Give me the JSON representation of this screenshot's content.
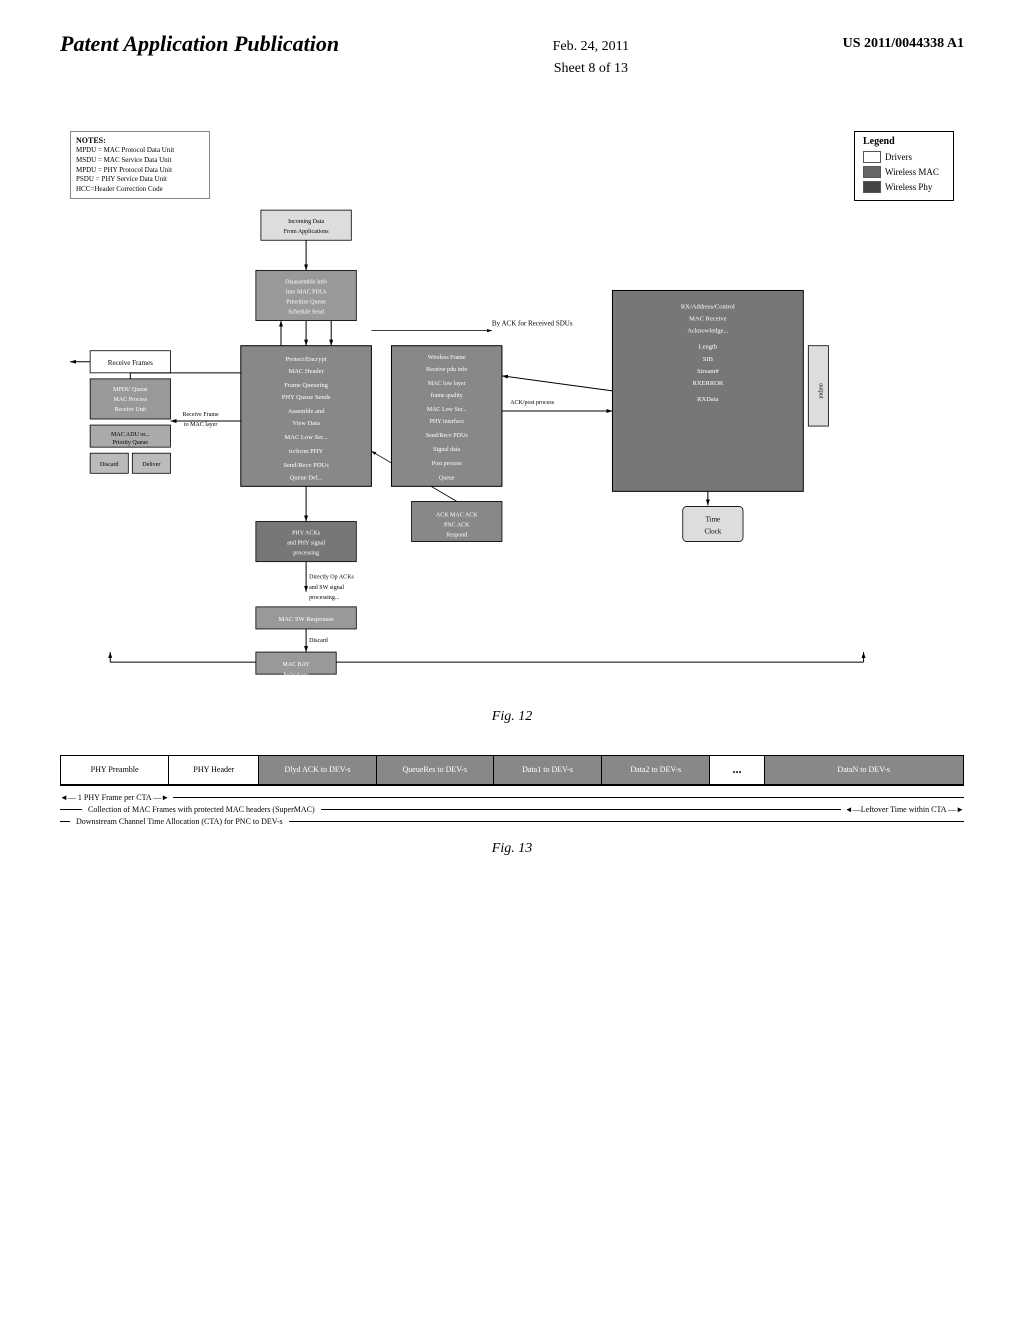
{
  "header": {
    "title": "Patent Application Publication",
    "date": "Feb. 24, 2011",
    "sheet": "Sheet 8 of 13",
    "patent": "US 2011/0044338 A1"
  },
  "fig12": {
    "label": "Fig. 12",
    "notes": {
      "title": "NOTES:",
      "lines": [
        "MPDU = MAC Protocol Data Unit",
        "MSDU = MAC Service Data Unit",
        "MPDU = PHY Protocol Data Unit",
        "PSDU = PHY Service Data Unit",
        "HCC=Header Correction Code"
      ]
    },
    "legend": {
      "title": "Legend",
      "items": [
        {
          "label": "Drivers",
          "shade": "white"
        },
        {
          "label": "Wireless MAC",
          "shade": "dark"
        },
        {
          "label": "Wireless Phy",
          "shade": "darker"
        }
      ]
    }
  },
  "fig13": {
    "label": "Fig. 13",
    "header_cells": [
      {
        "text": "PHY Preamble",
        "shade": "light"
      },
      {
        "text": "PHY Header",
        "shade": "light"
      },
      {
        "text": "Dlyd ACK to DEV-s",
        "shade": "dark"
      },
      {
        "text": "QueueRes to DEV-s",
        "shade": "dark"
      },
      {
        "text": "Data1 to DEV-s",
        "shade": "dark"
      },
      {
        "text": "Data2 to DEV-s",
        "shade": "dark"
      },
      {
        "text": "...",
        "shade": "light",
        "dots": true
      },
      {
        "text": "DataN to DEV-s",
        "shade": "dark"
      }
    ],
    "arrow1_left": "1 PHY Frame per CTA",
    "arrow1_right": "",
    "arrow2_label": "Collection of MAC Frames with protected MAC headers (SuperMAC)",
    "arrow2_right": "Leftover Time within CTA",
    "arrow3_label": "Downstream Channel Time Allocation (CTA) for PNC to DEV-s"
  }
}
